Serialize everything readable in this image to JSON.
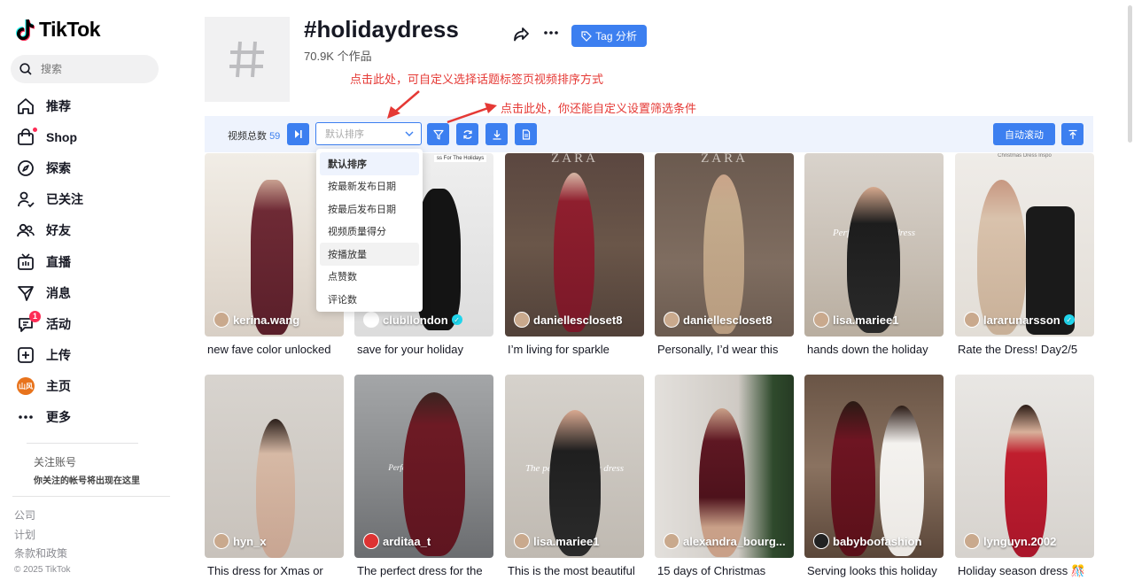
{
  "brand": {
    "name": "TikTok"
  },
  "search": {
    "placeholder": "搜索"
  },
  "nav": {
    "items": [
      {
        "label": "推荐",
        "icon": "home-icon"
      },
      {
        "label": "Shop",
        "icon": "shop-bag-icon"
      },
      {
        "label": "探索",
        "icon": "compass-icon"
      },
      {
        "label": "已关注",
        "icon": "following-icon"
      },
      {
        "label": "好友",
        "icon": "friends-icon"
      },
      {
        "label": "直播",
        "icon": "live-tv-icon"
      },
      {
        "label": "消息",
        "icon": "send-icon"
      },
      {
        "label": "活动",
        "icon": "activity-icon",
        "badge": "1"
      },
      {
        "label": "上传",
        "icon": "upload-plus-icon"
      },
      {
        "label": "主页",
        "icon": "avatar",
        "avatar_text": "山风"
      },
      {
        "label": "更多",
        "icon": "more-dots-icon"
      }
    ]
  },
  "follow_section": {
    "heading": "关注账号",
    "subtext": "你关注的帐号将出现在这里"
  },
  "footer": {
    "links": [
      "公司",
      "计划",
      "条款和政策"
    ],
    "copyright": "© 2025 TikTok"
  },
  "tag": {
    "title": "#holidaydress",
    "count": "70.9K 个作品",
    "analysis_button": "Tag 分析"
  },
  "annotations": {
    "sort_hint": "点击此处，可自定义选择话题标签页视频排序方式",
    "filter_hint": "点击此处，你还能自定义设置筛选条件"
  },
  "toolbar": {
    "total_label": "视频总数",
    "total_value": "59",
    "sort_placeholder": "默认排序",
    "auto_scroll": "自动滚动"
  },
  "sort_options": [
    "默认排序",
    "按最新发布日期",
    "按最后发布日期",
    "视频质量得分",
    "按播放量",
    "点赞数",
    "评论数"
  ],
  "videos": [
    {
      "author": "kerina.wang",
      "caption": "new fave color unlocked",
      "verified": false
    },
    {
      "author": "clubllondon",
      "caption": "save for your holiday",
      "verified": true,
      "overlay": "ss For The Holidays"
    },
    {
      "author": "daniellescloset8",
      "caption": "I’m living for sparkle",
      "verified": false,
      "overlay": "ZARA"
    },
    {
      "author": "daniellescloset8",
      "caption": "Personally, I’d wear this",
      "verified": false,
      "overlay": "ZARA"
    },
    {
      "author": "lisa.mariee1",
      "caption": "hands down the holiday",
      "verified": false,
      "overlay": "Perfect holiday dress"
    },
    {
      "author": "lararunarsson",
      "caption": "Rate the Dress! Day2/5",
      "verified": true,
      "overlay": "Christmas Dress Inspo"
    },
    {
      "author": "hyn_x",
      "caption": "This dress for Xmas or",
      "verified": false
    },
    {
      "author": "arditaa_t",
      "caption": "The perfect dress for the",
      "verified": false,
      "overlay": "Perfect Holiday Dress"
    },
    {
      "author": "lisa.mariee1",
      "caption": "This is the most beautiful",
      "verified": false,
      "overlay": "The perfect holiday dress"
    },
    {
      "author": "alexandra_bourg...",
      "caption": "15 days of Christmas",
      "verified": false
    },
    {
      "author": "babyboofashion",
      "caption": "Serving looks this holiday",
      "verified": false
    },
    {
      "author": "lynguyn.2002",
      "caption": "Holiday season dress 🎊",
      "verified": false
    }
  ]
}
